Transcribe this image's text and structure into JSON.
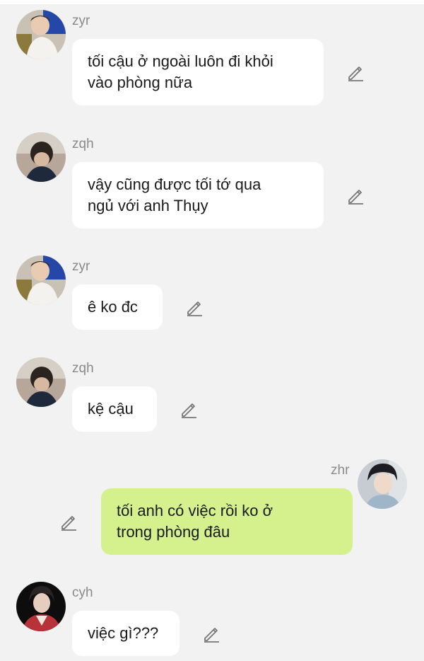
{
  "messages": [
    {
      "sender": "zyr",
      "text": "tối cậu ở ngoài luôn đi khỏi\nvào phòng nữa",
      "side": "left",
      "avatar_icon": "zyr-avatar"
    },
    {
      "sender": "zqh",
      "text": "vậy cũng được tối tớ qua\nngủ với anh Thụy",
      "side": "left",
      "avatar_icon": "zqh-avatar"
    },
    {
      "sender": "zyr",
      "text": "ê ko đc",
      "side": "left",
      "avatar_icon": "zyr-avatar"
    },
    {
      "sender": "zqh",
      "text": "kệ cậu",
      "side": "left",
      "avatar_icon": "zqh-avatar"
    },
    {
      "sender": "zhr",
      "text": "tối anh có việc rồi ko ở\ntrong phòng đâu",
      "side": "right",
      "avatar_icon": "zhr-avatar"
    },
    {
      "sender": "cyh",
      "text": "việc gì???",
      "side": "left",
      "avatar_icon": "cyh-avatar"
    }
  ],
  "edit_icon": "pencil-edit-icon",
  "colors": {
    "background": "#f2f2f2",
    "left_bubble": "#ffffff",
    "right_bubble": "#d4f18e",
    "name_text": "#8a8a8a",
    "message_text": "#1a1a1a",
    "icon": "#777777"
  }
}
